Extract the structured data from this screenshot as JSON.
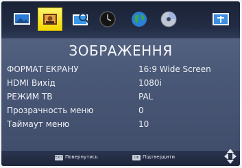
{
  "tabs": [
    {
      "icon": "picture-icon"
    },
    {
      "icon": "image-settings-icon",
      "active": true
    },
    {
      "icon": "channel-search-icon"
    },
    {
      "icon": "clock-icon"
    },
    {
      "icon": "globe-icon"
    },
    {
      "icon": "disc-icon"
    },
    {
      "icon": "system-icon"
    }
  ],
  "page_title": "ЗОБРАЖЕННЯ",
  "settings": [
    {
      "label": "ФОРМАТ ЕКРАНУ",
      "value": "16:9 Wide Screen"
    },
    {
      "label": "HDMI Вихід",
      "value": "1080i"
    },
    {
      "label": "РЕЖИМ ТВ",
      "value": "PAL"
    },
    {
      "label": "Прозрачность меню",
      "value": "0"
    },
    {
      "label": "Таймаут меню",
      "value": "10"
    }
  ],
  "footer": {
    "back_key": "EXIT",
    "back_label": "Повернутись",
    "ok_key": "OK",
    "ok_label": "Підтвердити"
  },
  "colors": {
    "active_tab": "#f2d800",
    "background": "#4a5877",
    "selected_row": "#262f45"
  }
}
